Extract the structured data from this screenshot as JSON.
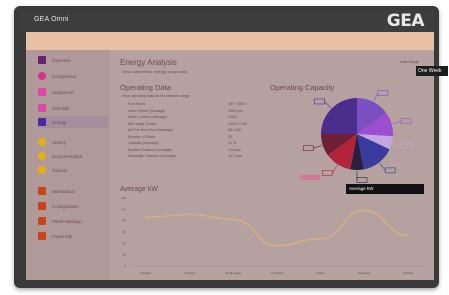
{
  "window": {
    "app_title": "GEA Omni",
    "brand": "GEA"
  },
  "sidebar": {
    "items": [
      {
        "label": "Overview",
        "icon": "grid-icon"
      },
      {
        "label": "Compressor",
        "icon": "compressor-icon"
      },
      {
        "label": "Sequencer",
        "icon": "sequencer-icon"
      },
      {
        "label": "Omnilink",
        "icon": "link-icon"
      },
      {
        "label": "Energy",
        "icon": "energy-icon",
        "active": true
      },
      {
        "label": "History",
        "icon": "history-icon"
      },
      {
        "label": "Documentation",
        "icon": "document-icon"
      },
      {
        "label": "Tutorial",
        "icon": "tutorial-icon"
      },
      {
        "label": "Mechanical",
        "icon": "mechanical-icon"
      },
      {
        "label": "Configuration",
        "icon": "configuration-icon"
      },
      {
        "label": "Panel Settings",
        "icon": "settings-icon"
      },
      {
        "label": "Panel Info",
        "icon": "info-icon"
      }
    ]
  },
  "main": {
    "title": "Energy Analysis",
    "subtitle": "View compressor energy usage data",
    "date_range_label": "Date Range",
    "date_range_value": "One Week",
    "operating": {
      "title": "Operating Data",
      "description": "View operating data for the selected range",
      "rows": [
        {
          "key": "Run Hours",
          "value": "167 / 168 h"
        },
        {
          "key": "Motor Speed (Average)",
          "value": "3450 rpm"
        },
        {
          "key": "Motor Current (Average)",
          "value": "236 A"
        },
        {
          "key": "kW Usage (Total)",
          "value": "14407.2 kW"
        },
        {
          "key": "kW Per Run Hour (Average)",
          "value": "86.3 kW"
        },
        {
          "key": "Number of Starts",
          "value": "26"
        },
        {
          "key": "Capacity (Average)",
          "value": "91 %"
        },
        {
          "key": "Suction Pressure (Average)",
          "value": "3.6 psia"
        },
        {
          "key": "Discharge Pressure (Average)",
          "value": "157 psia"
        }
      ]
    },
    "capacity_title": "Operating Capacity",
    "average_selector": "Average kW",
    "average_title": "Average kW"
  },
  "colors": {
    "accent": "#e3b58f",
    "screen": "#b5a2a0",
    "line": "#d9b07d"
  },
  "chart_data": {
    "type": "line",
    "title": "Average kW",
    "x": [
      "Monday",
      "Tuesday",
      "Wednesday",
      "Thursday",
      "Friday",
      "Saturday",
      "Sunday"
    ],
    "series": [
      {
        "values": [
          86,
          91,
          82,
          36,
          48,
          98,
          54
        ]
      }
    ],
    "ylim": [
      0,
      120
    ],
    "yticks": [
      0,
      20,
      40,
      60,
      80,
      100,
      120
    ],
    "grid": false
  },
  "pie_data": {
    "type": "pie",
    "slices": [
      {
        "value": 15,
        "color": "#7a4fc0"
      },
      {
        "value": 11,
        "color": "#9b4fd0"
      },
      {
        "value": 6,
        "color": "#c2a7e0"
      },
      {
        "value": 15,
        "color": "#3b3b9f"
      },
      {
        "value": 6,
        "color": "#2a1f3f"
      },
      {
        "value": 12,
        "color": "#b3243a"
      },
      {
        "value": 10,
        "color": "#6e1f34"
      },
      {
        "value": 25,
        "color": "#4b2e8c"
      }
    ]
  }
}
